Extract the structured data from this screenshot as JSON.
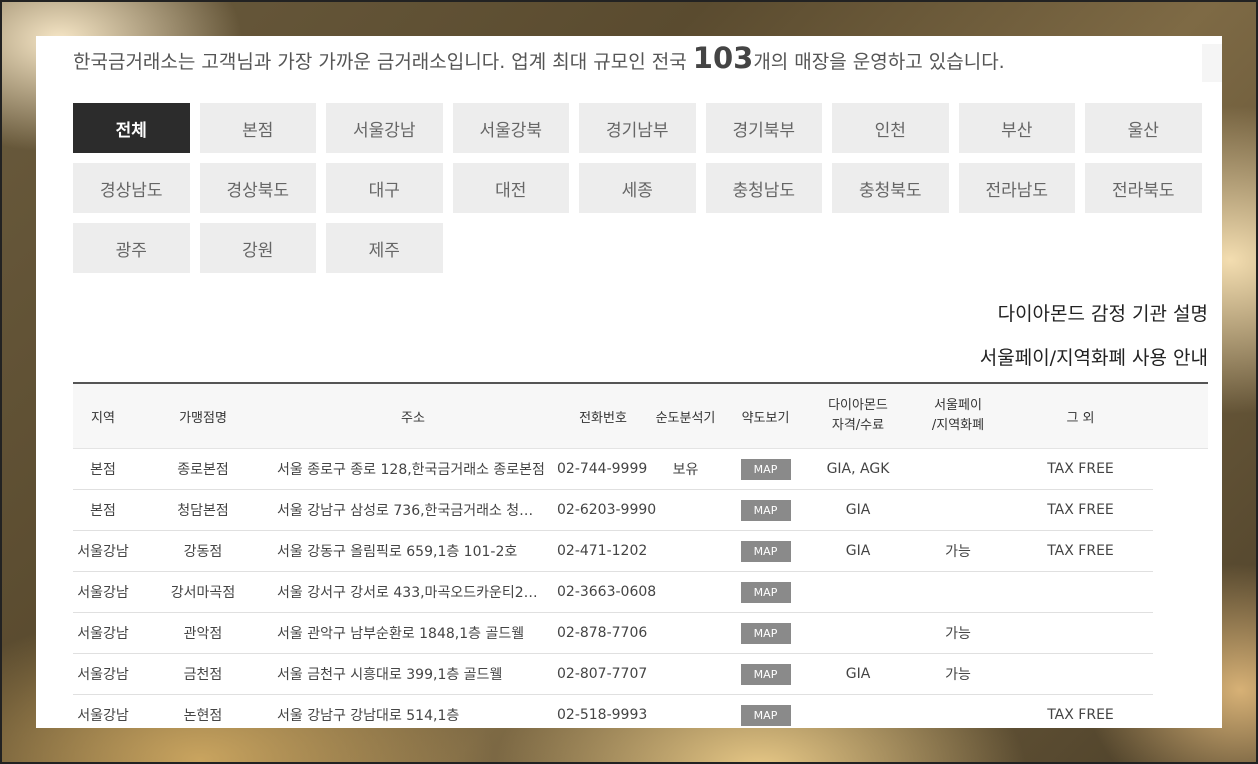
{
  "intro": {
    "prefix": "한국금거래소는 고객님과 가장 가까운 금거래소입니다. 업계 최대 규모인 전국 ",
    "count": "103",
    "suffix": "개의 매장을 운영하고 있습니다."
  },
  "regions": [
    "전체",
    "본점",
    "서울강남",
    "서울강북",
    "경기남부",
    "경기북부",
    "인천",
    "부산",
    "울산",
    "경상남도",
    "경상북도",
    "대구",
    "대전",
    "세종",
    "충청남도",
    "충청북도",
    "전라남도",
    "전라북도",
    "광주",
    "강원",
    "제주"
  ],
  "active_region": "전체",
  "links": {
    "diamond_info": "다이아몬드 감정 기관 설명",
    "seoulpay_info": "서울페이/지역화폐 사용 안내"
  },
  "table": {
    "headers": {
      "region": "지역",
      "store": "가맹점명",
      "address": "주소",
      "phone": "전화번호",
      "purity": "순도분석기",
      "map": "약도보기",
      "diamond_1": "다이아몬드",
      "diamond_2": "자격/수료",
      "seoulpay_1": "서울페이",
      "seoulpay_2": "/지역화폐",
      "other": "그 외"
    },
    "map_label": "MAP",
    "rows": [
      {
        "region": "본점",
        "store": "종로본점",
        "address": "서울 종로구 종로 128,한국금거래소 종로본점",
        "phone": "02-744-9999",
        "purity": "보유",
        "diamond": "GIA, AGK",
        "seoulpay": "",
        "other": "TAX FREE"
      },
      {
        "region": "본점",
        "store": "청담본점",
        "address": "서울 강남구 삼성로 736,한국금거래소 청담…",
        "phone": "02-6203-9990",
        "purity": "",
        "diamond": "GIA",
        "seoulpay": "",
        "other": "TAX FREE"
      },
      {
        "region": "서울강남",
        "store": "강동점",
        "address": "서울 강동구 올림픽로 659,1층 101-2호",
        "phone": "02-471-1202",
        "purity": "",
        "diamond": "GIA",
        "seoulpay": "가능",
        "other": "TAX FREE"
      },
      {
        "region": "서울강남",
        "store": "강서마곡점",
        "address": "서울 강서구 강서로 433,마곡오드카운티2차 …",
        "phone": "02-3663-0608",
        "purity": "",
        "diamond": "",
        "seoulpay": "",
        "other": ""
      },
      {
        "region": "서울강남",
        "store": "관악점",
        "address": "서울 관악구 남부순환로 1848,1층 골드웰",
        "phone": "02-878-7706",
        "purity": "",
        "diamond": "",
        "seoulpay": "가능",
        "other": ""
      },
      {
        "region": "서울강남",
        "store": "금천점",
        "address": "서울 금천구 시흥대로 399,1층 골드웰",
        "phone": "02-807-7707",
        "purity": "",
        "diamond": "GIA",
        "seoulpay": "가능",
        "other": ""
      },
      {
        "region": "서울강남",
        "store": "논현점",
        "address": "서울 강남구 강남대로 514,1층",
        "phone": "02-518-9993",
        "purity": "",
        "diamond": "",
        "seoulpay": "",
        "other": "TAX FREE"
      }
    ]
  }
}
